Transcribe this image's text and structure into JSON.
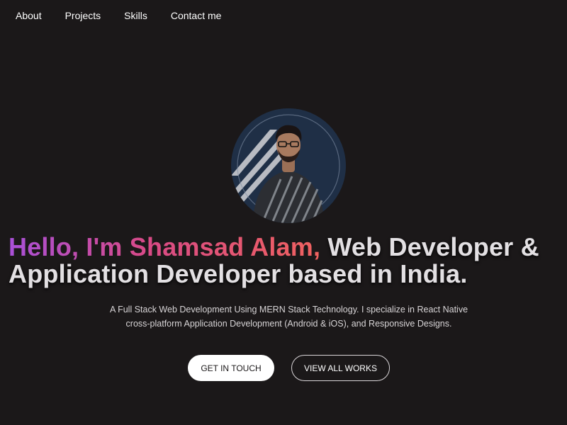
{
  "nav": {
    "items": [
      {
        "label": "About"
      },
      {
        "label": "Projects"
      },
      {
        "label": "Skills"
      },
      {
        "label": "Contact me"
      }
    ]
  },
  "hero": {
    "headline_highlight": "Hello, I'm Shamsad Alam,",
    "headline_rest": " Web Developer & Application Developer based in India.",
    "description": "A Full Stack Web Development Using MERN Stack Technology. I specialize in React Native cross-platform Application Development (Android & iOS), and Responsive Designs.",
    "cta_primary": "GET IN TOUCH",
    "cta_secondary": "VIEW ALL WORKS"
  },
  "colors": {
    "background": "#1b1819",
    "gradient_start": "#a950d8",
    "gradient_mid": "#d94a86",
    "gradient_end": "#f0625f",
    "text_light": "#e3e0e3"
  }
}
